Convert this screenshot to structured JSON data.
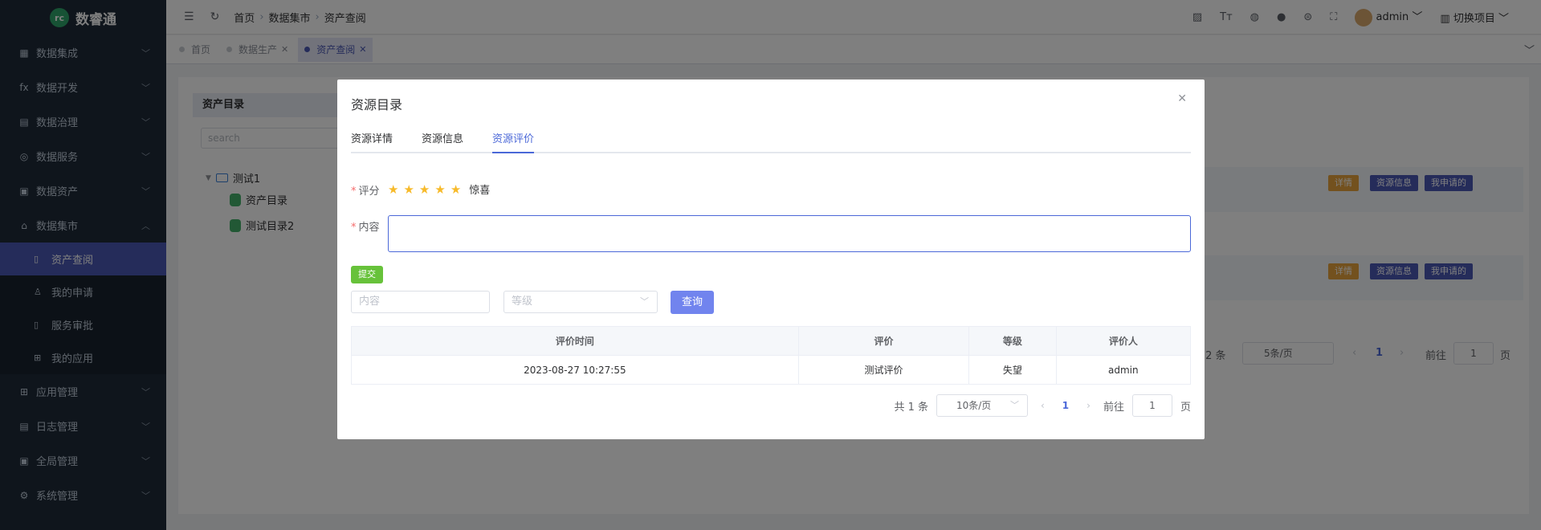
{
  "app": {
    "name": "数睿通"
  },
  "sidebar": {
    "items": [
      {
        "label": "数据集成",
        "icon": "grid-icon"
      },
      {
        "label": "数据开发",
        "icon": "function-icon"
      },
      {
        "label": "数据治理",
        "icon": "table-icon"
      },
      {
        "label": "数据服务",
        "icon": "service-icon"
      },
      {
        "label": "数据资产",
        "icon": "asset-icon"
      },
      {
        "label": "数据集市",
        "icon": "market-icon"
      }
    ],
    "sub_items": [
      {
        "label": "资产查阅",
        "active": true
      },
      {
        "label": "我的申请"
      },
      {
        "label": "服务审批"
      },
      {
        "label": "我的应用"
      }
    ],
    "items_after": [
      {
        "label": "应用管理"
      },
      {
        "label": "日志管理"
      },
      {
        "label": "全局管理"
      },
      {
        "label": "系统管理"
      }
    ]
  },
  "header": {
    "breadcrumbs": [
      "首页",
      "数据集市",
      "资产查阅"
    ],
    "user": "admin",
    "switch_project": "切换项目"
  },
  "tags": [
    {
      "label": "首页"
    },
    {
      "label": "数据生产",
      "closable": true
    },
    {
      "label": "资产查阅",
      "closable": true,
      "active": true
    }
  ],
  "background": {
    "tree_title": "资产目录",
    "search_placeholder": "search",
    "tree_nodes": [
      "测试1",
      "资产目录",
      "测试目录2"
    ],
    "row_buttons": [
      "详情",
      "资源信息",
      "我申请的"
    ],
    "pagination": {
      "total": "共 2 条",
      "page_size": "5条/页",
      "current": "1",
      "goto": "前往",
      "page_input": "1",
      "page_unit": "页"
    }
  },
  "dialog": {
    "title": "资源目录",
    "tabs": [
      "资源详情",
      "资源信息",
      "资源评价"
    ],
    "active_tab": 2,
    "rating_label": "评分",
    "rating_value": 5,
    "rating_max": 5,
    "rating_text": "惊喜",
    "content_label": "内容",
    "submit_label": "提交",
    "filter_content_placeholder": "内容",
    "filter_level_placeholder": "等级",
    "query_label": "查询",
    "table": {
      "columns": [
        "评价时间",
        "评价",
        "等级",
        "评价人"
      ],
      "rows": [
        [
          "2023-08-27 10:27:55",
          "测试评价",
          "失望",
          "admin"
        ]
      ]
    },
    "pagination": {
      "total": "共 1 条",
      "page_size": "10条/页",
      "current": "1",
      "goto": "前往",
      "page_input": "1",
      "page_unit": "页"
    }
  },
  "colors": {
    "sidebar_bg": "#1e2a38",
    "accent": "#4b58b4",
    "star": "#f7ba2a",
    "submit": "#67c23a",
    "query": "#7184ee"
  }
}
